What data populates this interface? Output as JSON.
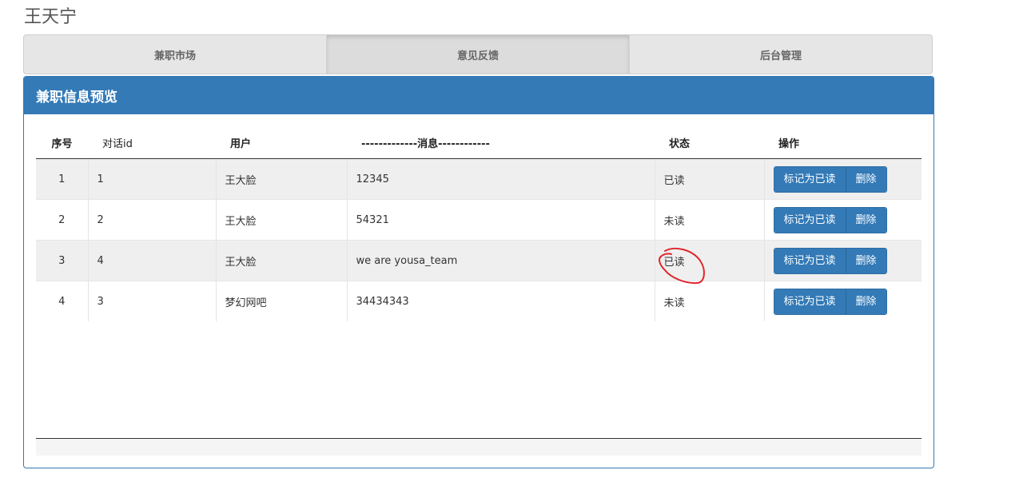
{
  "user": {
    "name": "王天宁"
  },
  "nav": {
    "tabs": [
      {
        "label": "兼职市场",
        "active": false
      },
      {
        "label": "意见反馈",
        "active": true
      },
      {
        "label": "后台管理",
        "active": false
      }
    ]
  },
  "panel": {
    "title": "兼职信息预览"
  },
  "table": {
    "headers": [
      "序号",
      "对话id",
      "用户",
      "-------------消息------------",
      "状态",
      "操作"
    ],
    "rows": [
      {
        "index": "1",
        "dialog_id": "1",
        "user": "王大脸",
        "message": "12345",
        "status": "已读"
      },
      {
        "index": "2",
        "dialog_id": "2",
        "user": "王大脸",
        "message": "54321",
        "status": "未读"
      },
      {
        "index": "3",
        "dialog_id": "4",
        "user": "王大脸",
        "message": "we are yousa_team",
        "status": "已读"
      },
      {
        "index": "4",
        "dialog_id": "3",
        "user": "梦幻网吧",
        "message": "34434343",
        "status": "未读"
      }
    ],
    "actions": {
      "mark_read_label": "标记为已读",
      "delete_label": "删除"
    }
  },
  "colors": {
    "primary": "#337ab7",
    "annotation": "#e0262c"
  }
}
